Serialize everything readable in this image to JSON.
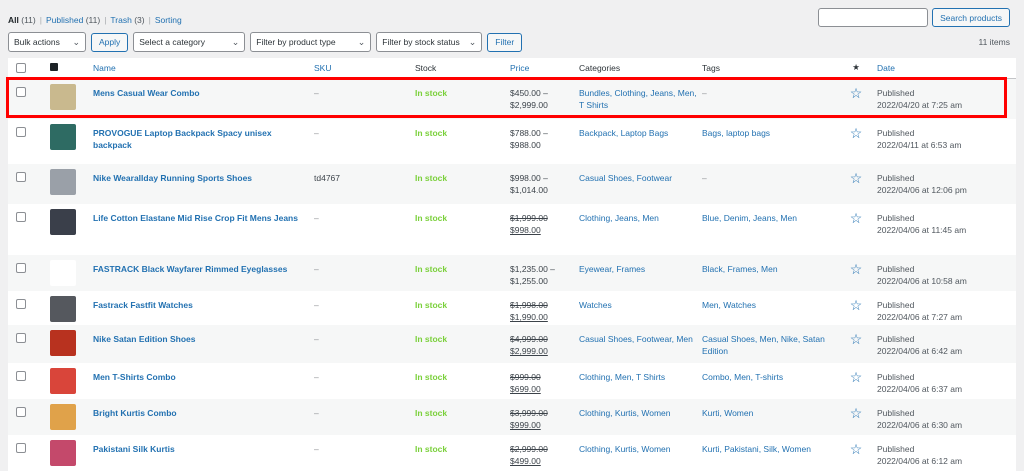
{
  "views": [
    {
      "label": "All",
      "count": "(11)",
      "current": true
    },
    {
      "label": "Published",
      "count": "(11)",
      "current": false
    },
    {
      "label": "Trash",
      "count": "(3)",
      "current": false
    },
    {
      "label": "Sorting",
      "count": "",
      "current": false
    }
  ],
  "search": {
    "placeholder": "",
    "button": "Search products"
  },
  "toolbar": {
    "bulk_actions": "Bulk actions",
    "apply": "Apply",
    "category": "Select a category",
    "product_type": "Filter by product type",
    "stock_status": "Filter by stock status",
    "filter": "Filter",
    "items_count": "11 items"
  },
  "columns": {
    "image_icon": "image-icon",
    "name": "Name",
    "sku": "SKU",
    "stock": "Stock",
    "price": "Price",
    "categories": "Categories",
    "tags": "Tags",
    "featured_icon": "star-icon",
    "date": "Date"
  },
  "products": [
    {
      "name": "Mens Casual Wear Combo",
      "sku": "–",
      "stock": "In stock",
      "price_line1": "$450.00 –",
      "price_line2": "$2,999.00",
      "sale": false,
      "categories": "Bundles, Clothing, Jeans, Men, T Shirts",
      "tags": "–",
      "status": "Published",
      "date": "2022/04/20 at 7:25 am",
      "thumb_color": "#c9b98e"
    },
    {
      "name": "PROVOGUE Laptop Backpack Spacy unisex backpack",
      "sku": "–",
      "stock": "In stock",
      "price_line1": "$788.00 –",
      "price_line2": "$988.00",
      "sale": false,
      "categories": "Backpack, Laptop Bags",
      "tags": "Bags, laptop bags",
      "status": "Published",
      "date": "2022/04/11 at 6:53 am",
      "thumb_color": "#2e6b63"
    },
    {
      "name": "Nike Wearallday Running Sports Shoes",
      "sku": "td4767",
      "stock": "In stock",
      "price_line1": "$998.00 –",
      "price_line2": "$1,014.00",
      "sale": false,
      "categories": "Casual Shoes, Footwear",
      "tags": "–",
      "status": "Published",
      "date": "2022/04/06 at 12:06 pm",
      "thumb_color": "#9aa0a8"
    },
    {
      "name": "Life Cotton Elastane Mid Rise Crop Fit Mens Jeans",
      "sku": "–",
      "stock": "In stock",
      "price_line1": "$1,999.00",
      "price_line2": "$998.00",
      "sale": true,
      "categories": "Clothing, Jeans, Men",
      "tags": "Blue, Denim, Jeans, Men",
      "status": "Published",
      "date": "2022/04/06 at 11:45 am",
      "thumb_color": "#3a3f4a"
    },
    {
      "name": "FASTRACK Black Wayfarer Rimmed Eyeglasses",
      "sku": "–",
      "stock": "In stock",
      "price_line1": "$1,235.00 –",
      "price_line2": "$1,255.00",
      "sale": false,
      "categories": "Eyewear, Frames",
      "tags": "Black, Frames, Men",
      "status": "Published",
      "date": "2022/04/06 at 10:58 am",
      "thumb_color": "#ffffff"
    },
    {
      "name": "Fastrack Fastfit Watches",
      "sku": "–",
      "stock": "In stock",
      "price_line1": "$1,998.00",
      "price_line2": "$1,990.00",
      "sale": true,
      "categories": "Watches",
      "tags": "Men, Watches",
      "status": "Published",
      "date": "2022/04/06 at 7:27 am",
      "thumb_color": "#55585e"
    },
    {
      "name": "Nike Satan Edition Shoes",
      "sku": "–",
      "stock": "In stock",
      "price_line1": "$4,999.00",
      "price_line2": "$2,999.00",
      "sale": true,
      "categories": "Casual Shoes, Footwear, Men",
      "tags": "Casual Shoes, Men, Nike, Satan Edition",
      "status": "Published",
      "date": "2022/04/06 at 6:42 am",
      "thumb_color": "#b8321f"
    },
    {
      "name": "Men T-Shirts Combo",
      "sku": "–",
      "stock": "In stock",
      "price_line1": "$999.00",
      "price_line2": "$699.00",
      "sale": true,
      "categories": "Clothing, Men, T Shirts",
      "tags": "Combo, Men, T-shirts",
      "status": "Published",
      "date": "2022/04/06 at 6:37 am",
      "thumb_color": "#d9453a"
    },
    {
      "name": "Bright Kurtis Combo",
      "sku": "–",
      "stock": "In stock",
      "price_line1": "$3,999.00",
      "price_line2": "$999.00",
      "sale": true,
      "categories": "Clothing, Kurtis, Women",
      "tags": "Kurti, Women",
      "status": "Published",
      "date": "2022/04/06 at 6:30 am",
      "thumb_color": "#e0a24a"
    },
    {
      "name": "Pakistani Silk Kurtis",
      "sku": "–",
      "stock": "In stock",
      "price_line1": "$2,999.00",
      "price_line2": "$499.00",
      "sale": true,
      "categories": "Clothing, Kurtis, Women",
      "tags": "Kurti, Pakistani, Silk, Women",
      "status": "Published",
      "date": "2022/04/06 at 6:12 am",
      "thumb_color": "#c4496b"
    }
  ]
}
